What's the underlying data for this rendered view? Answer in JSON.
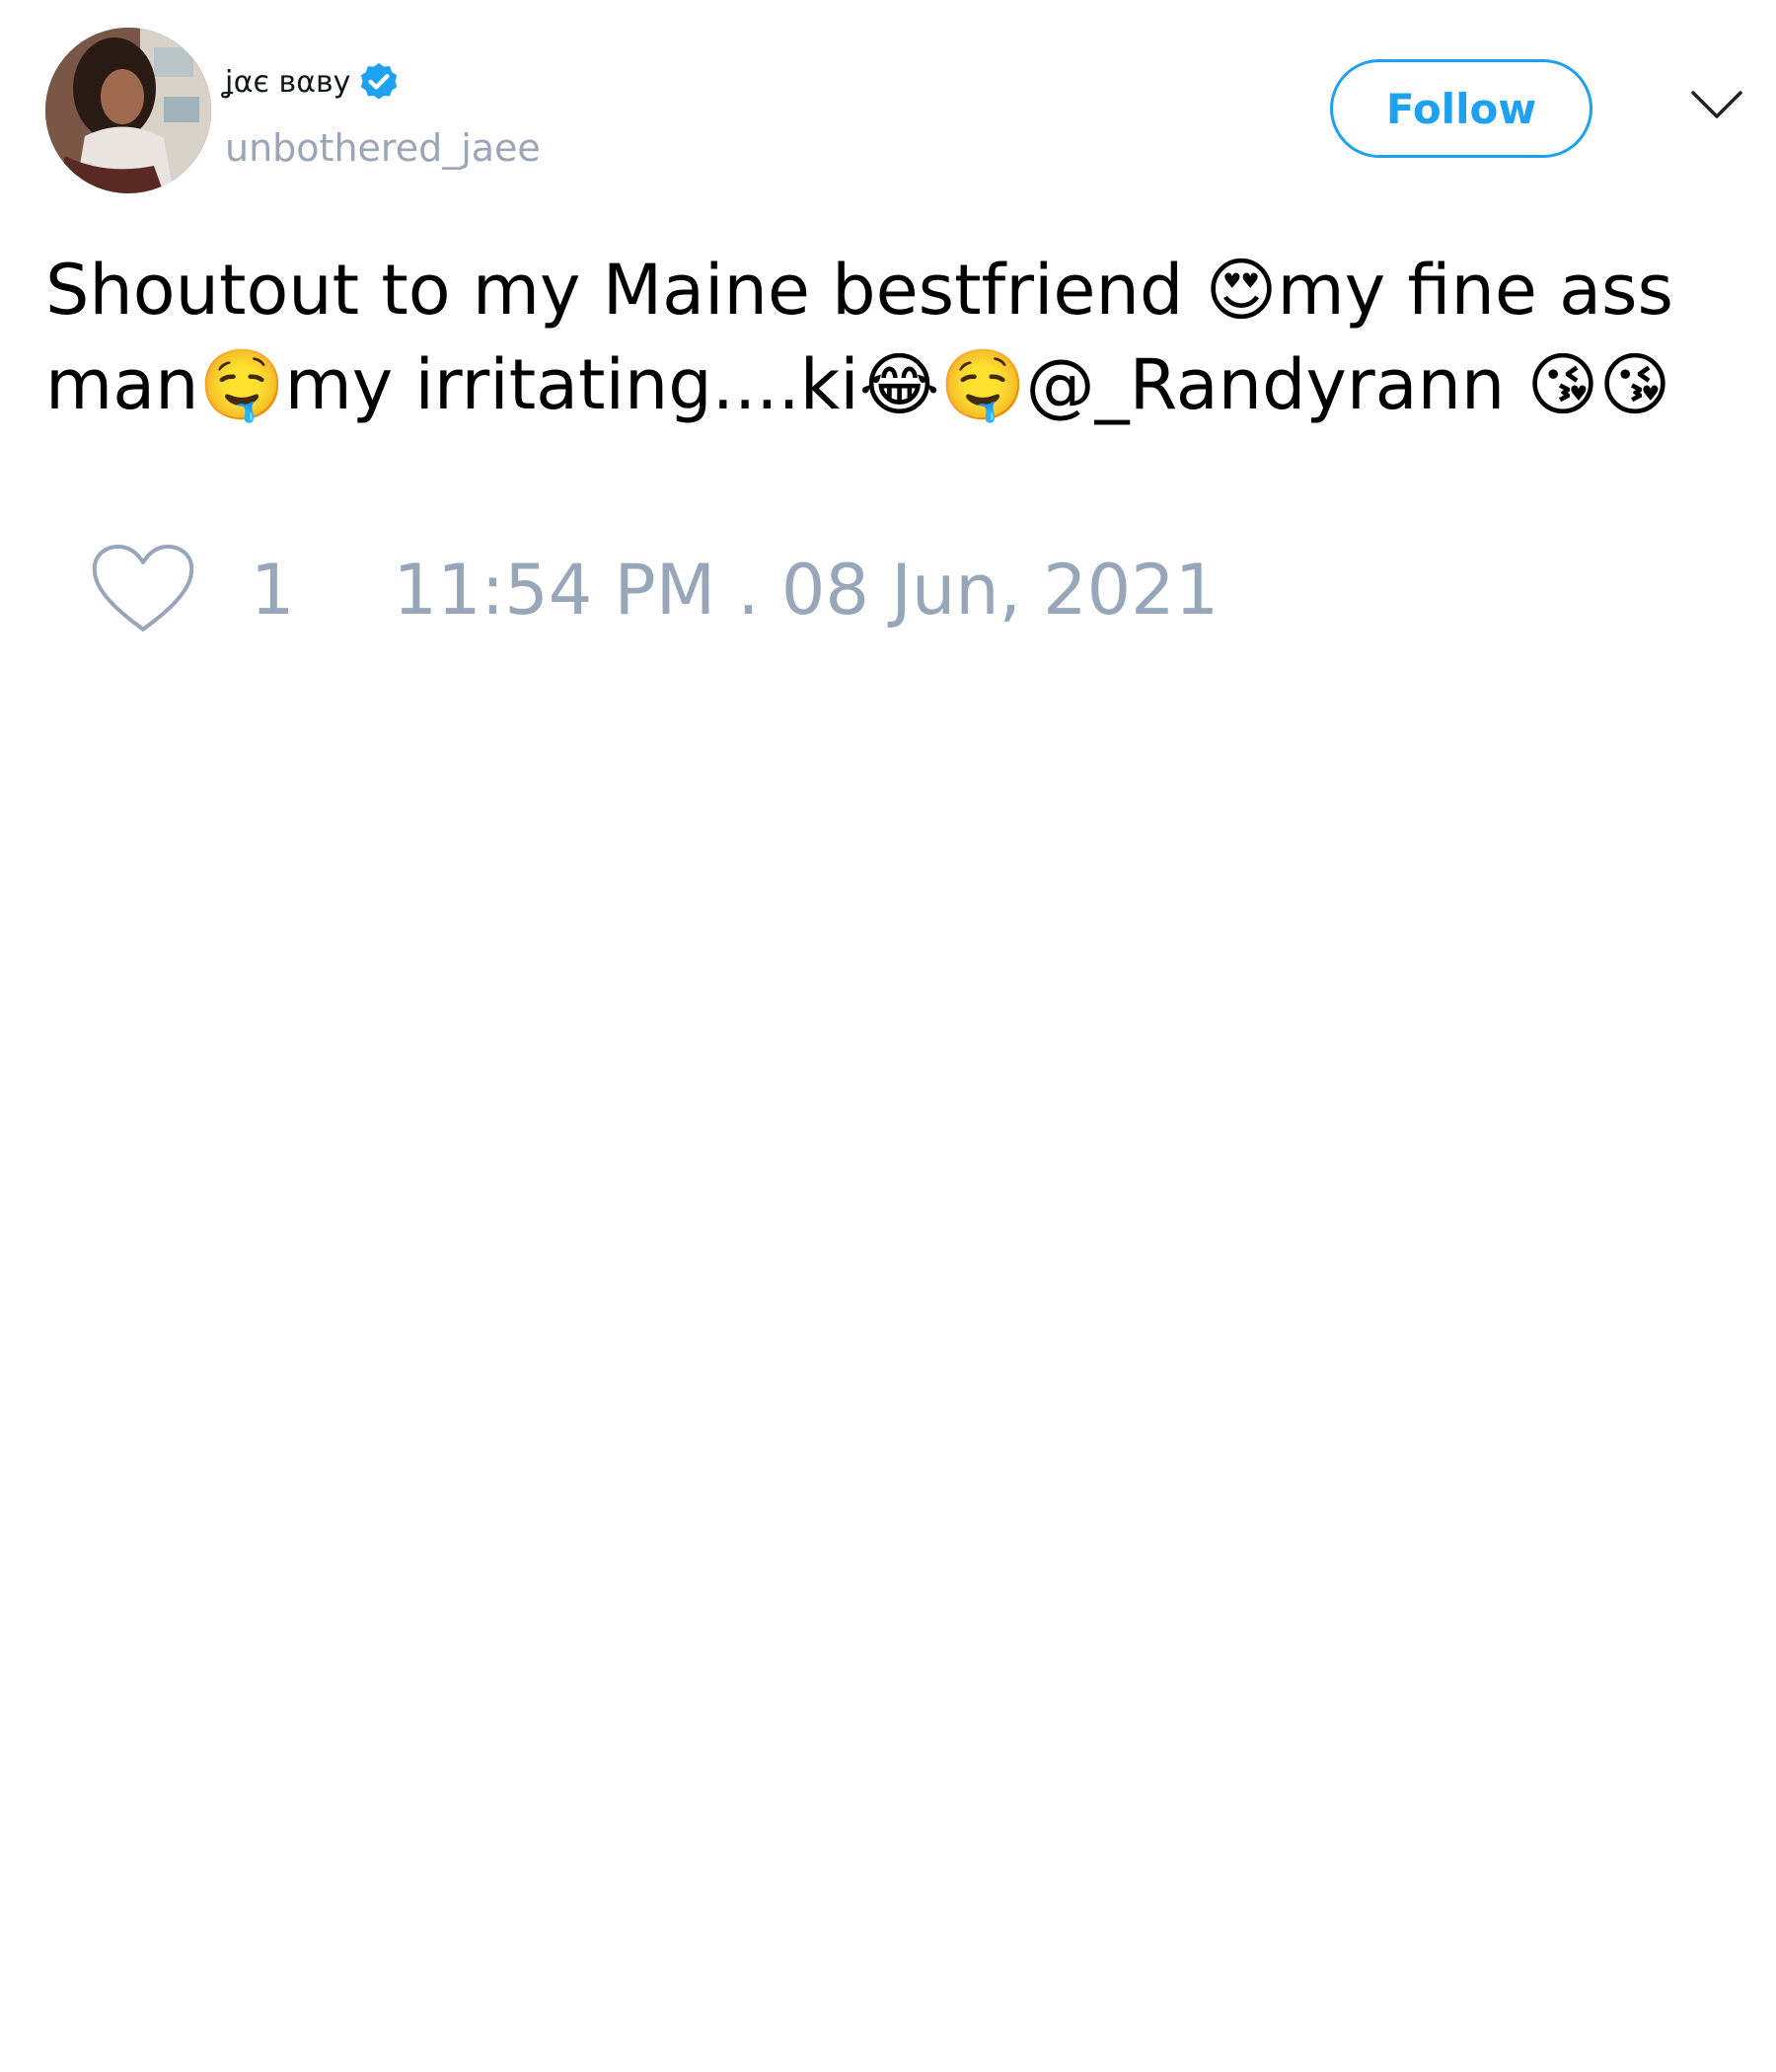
{
  "tweet": {
    "author": {
      "display_name": "ʝαє вαву",
      "handle": "unbothered_jaee",
      "verified": true,
      "avatar_icon": "profile-photo"
    },
    "follow_label": "Follow",
    "menu_icon": "chevron-down-icon",
    "text": "Shoutout to my Maine bestfriend 😍my fine ass man🤤my irritating....ki😂🤤@_Randyrann 😘😘",
    "like_icon": "heart-outline-icon",
    "like_count": "1",
    "timestamp": "11:54 PM . 08 Jun, 2021"
  },
  "colors": {
    "accent": "#1da1f2",
    "muted": "#97a6b9",
    "text": "#000000"
  }
}
